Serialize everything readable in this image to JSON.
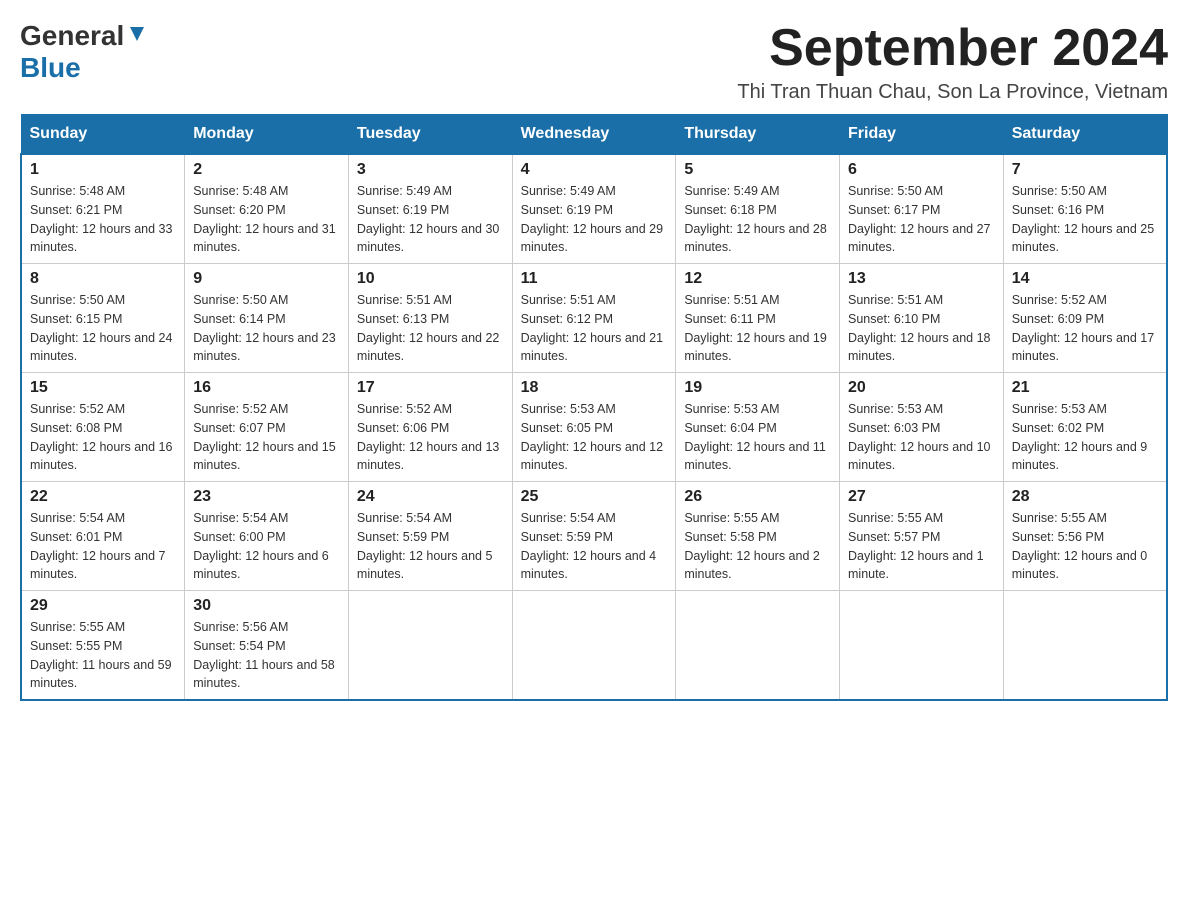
{
  "header": {
    "logo_general": "General",
    "logo_blue": "Blue",
    "month_year": "September 2024",
    "location": "Thi Tran Thuan Chau, Son La Province, Vietnam"
  },
  "days_of_week": [
    "Sunday",
    "Monday",
    "Tuesday",
    "Wednesday",
    "Thursday",
    "Friday",
    "Saturday"
  ],
  "weeks": [
    [
      {
        "day": "1",
        "sunrise": "Sunrise: 5:48 AM",
        "sunset": "Sunset: 6:21 PM",
        "daylight": "Daylight: 12 hours and 33 minutes."
      },
      {
        "day": "2",
        "sunrise": "Sunrise: 5:48 AM",
        "sunset": "Sunset: 6:20 PM",
        "daylight": "Daylight: 12 hours and 31 minutes."
      },
      {
        "day": "3",
        "sunrise": "Sunrise: 5:49 AM",
        "sunset": "Sunset: 6:19 PM",
        "daylight": "Daylight: 12 hours and 30 minutes."
      },
      {
        "day": "4",
        "sunrise": "Sunrise: 5:49 AM",
        "sunset": "Sunset: 6:19 PM",
        "daylight": "Daylight: 12 hours and 29 minutes."
      },
      {
        "day": "5",
        "sunrise": "Sunrise: 5:49 AM",
        "sunset": "Sunset: 6:18 PM",
        "daylight": "Daylight: 12 hours and 28 minutes."
      },
      {
        "day": "6",
        "sunrise": "Sunrise: 5:50 AM",
        "sunset": "Sunset: 6:17 PM",
        "daylight": "Daylight: 12 hours and 27 minutes."
      },
      {
        "day": "7",
        "sunrise": "Sunrise: 5:50 AM",
        "sunset": "Sunset: 6:16 PM",
        "daylight": "Daylight: 12 hours and 25 minutes."
      }
    ],
    [
      {
        "day": "8",
        "sunrise": "Sunrise: 5:50 AM",
        "sunset": "Sunset: 6:15 PM",
        "daylight": "Daylight: 12 hours and 24 minutes."
      },
      {
        "day": "9",
        "sunrise": "Sunrise: 5:50 AM",
        "sunset": "Sunset: 6:14 PM",
        "daylight": "Daylight: 12 hours and 23 minutes."
      },
      {
        "day": "10",
        "sunrise": "Sunrise: 5:51 AM",
        "sunset": "Sunset: 6:13 PM",
        "daylight": "Daylight: 12 hours and 22 minutes."
      },
      {
        "day": "11",
        "sunrise": "Sunrise: 5:51 AM",
        "sunset": "Sunset: 6:12 PM",
        "daylight": "Daylight: 12 hours and 21 minutes."
      },
      {
        "day": "12",
        "sunrise": "Sunrise: 5:51 AM",
        "sunset": "Sunset: 6:11 PM",
        "daylight": "Daylight: 12 hours and 19 minutes."
      },
      {
        "day": "13",
        "sunrise": "Sunrise: 5:51 AM",
        "sunset": "Sunset: 6:10 PM",
        "daylight": "Daylight: 12 hours and 18 minutes."
      },
      {
        "day": "14",
        "sunrise": "Sunrise: 5:52 AM",
        "sunset": "Sunset: 6:09 PM",
        "daylight": "Daylight: 12 hours and 17 minutes."
      }
    ],
    [
      {
        "day": "15",
        "sunrise": "Sunrise: 5:52 AM",
        "sunset": "Sunset: 6:08 PM",
        "daylight": "Daylight: 12 hours and 16 minutes."
      },
      {
        "day": "16",
        "sunrise": "Sunrise: 5:52 AM",
        "sunset": "Sunset: 6:07 PM",
        "daylight": "Daylight: 12 hours and 15 minutes."
      },
      {
        "day": "17",
        "sunrise": "Sunrise: 5:52 AM",
        "sunset": "Sunset: 6:06 PM",
        "daylight": "Daylight: 12 hours and 13 minutes."
      },
      {
        "day": "18",
        "sunrise": "Sunrise: 5:53 AM",
        "sunset": "Sunset: 6:05 PM",
        "daylight": "Daylight: 12 hours and 12 minutes."
      },
      {
        "day": "19",
        "sunrise": "Sunrise: 5:53 AM",
        "sunset": "Sunset: 6:04 PM",
        "daylight": "Daylight: 12 hours and 11 minutes."
      },
      {
        "day": "20",
        "sunrise": "Sunrise: 5:53 AM",
        "sunset": "Sunset: 6:03 PM",
        "daylight": "Daylight: 12 hours and 10 minutes."
      },
      {
        "day": "21",
        "sunrise": "Sunrise: 5:53 AM",
        "sunset": "Sunset: 6:02 PM",
        "daylight": "Daylight: 12 hours and 9 minutes."
      }
    ],
    [
      {
        "day": "22",
        "sunrise": "Sunrise: 5:54 AM",
        "sunset": "Sunset: 6:01 PM",
        "daylight": "Daylight: 12 hours and 7 minutes."
      },
      {
        "day": "23",
        "sunrise": "Sunrise: 5:54 AM",
        "sunset": "Sunset: 6:00 PM",
        "daylight": "Daylight: 12 hours and 6 minutes."
      },
      {
        "day": "24",
        "sunrise": "Sunrise: 5:54 AM",
        "sunset": "Sunset: 5:59 PM",
        "daylight": "Daylight: 12 hours and 5 minutes."
      },
      {
        "day": "25",
        "sunrise": "Sunrise: 5:54 AM",
        "sunset": "Sunset: 5:59 PM",
        "daylight": "Daylight: 12 hours and 4 minutes."
      },
      {
        "day": "26",
        "sunrise": "Sunrise: 5:55 AM",
        "sunset": "Sunset: 5:58 PM",
        "daylight": "Daylight: 12 hours and 2 minutes."
      },
      {
        "day": "27",
        "sunrise": "Sunrise: 5:55 AM",
        "sunset": "Sunset: 5:57 PM",
        "daylight": "Daylight: 12 hours and 1 minute."
      },
      {
        "day": "28",
        "sunrise": "Sunrise: 5:55 AM",
        "sunset": "Sunset: 5:56 PM",
        "daylight": "Daylight: 12 hours and 0 minutes."
      }
    ],
    [
      {
        "day": "29",
        "sunrise": "Sunrise: 5:55 AM",
        "sunset": "Sunset: 5:55 PM",
        "daylight": "Daylight: 11 hours and 59 minutes."
      },
      {
        "day": "30",
        "sunrise": "Sunrise: 5:56 AM",
        "sunset": "Sunset: 5:54 PM",
        "daylight": "Daylight: 11 hours and 58 minutes."
      },
      null,
      null,
      null,
      null,
      null
    ]
  ]
}
